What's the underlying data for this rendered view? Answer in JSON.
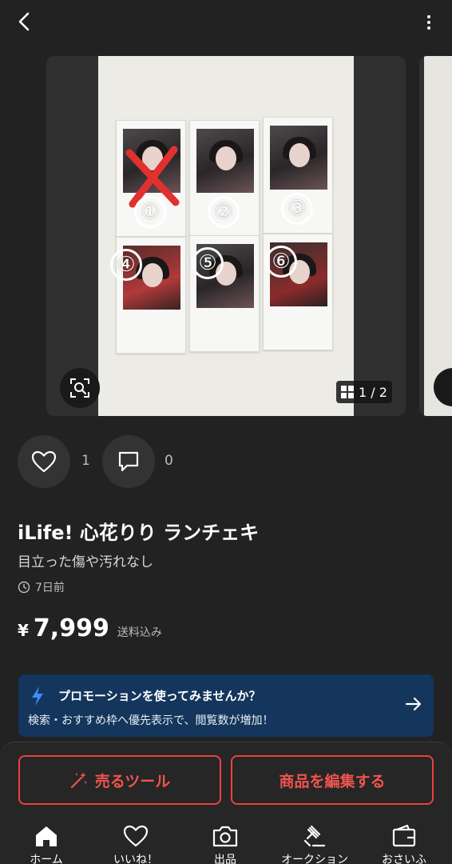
{
  "header": {
    "back_icon": "chevron-left-icon",
    "more_icon": "more-vertical-icon"
  },
  "gallery": {
    "current_page": "1",
    "total_pages": "2",
    "counter_text": "1 / 2",
    "photo_numbers": [
      "①",
      "②",
      "③",
      "④",
      "⑤",
      "⑥"
    ],
    "handwriting": [
      "",
      "",
      "",
      "",
      "",
      ""
    ]
  },
  "engagement": {
    "likes": "1",
    "comments": "0"
  },
  "product": {
    "title": "iLife! 心花りり ランチェキ",
    "condition": "目立った傷や汚れなし",
    "posted": "7日前",
    "currency": "¥",
    "price": "7,999",
    "shipping": "送料込み"
  },
  "promo": {
    "title": "プロモーションを使ってみませんか？",
    "description": "検索・おすすめ枠へ優先表示で、閲覧数が増加！"
  },
  "actions": {
    "sell_tool": "売るツール",
    "edit": "商品を編集する"
  },
  "tabs": [
    {
      "label": "ホーム",
      "icon": "home-icon"
    },
    {
      "label": "いいね！",
      "icon": "heart-icon"
    },
    {
      "label": "出品",
      "icon": "camera-icon"
    },
    {
      "label": "オークション",
      "icon": "gavel-icon"
    },
    {
      "label": "おさいふ",
      "icon": "wallet-icon"
    }
  ],
  "colors": {
    "background": "#222222",
    "accent_red": "#e8423f",
    "promo_blue": "#14365c",
    "promo_icon": "#3d8bff"
  }
}
